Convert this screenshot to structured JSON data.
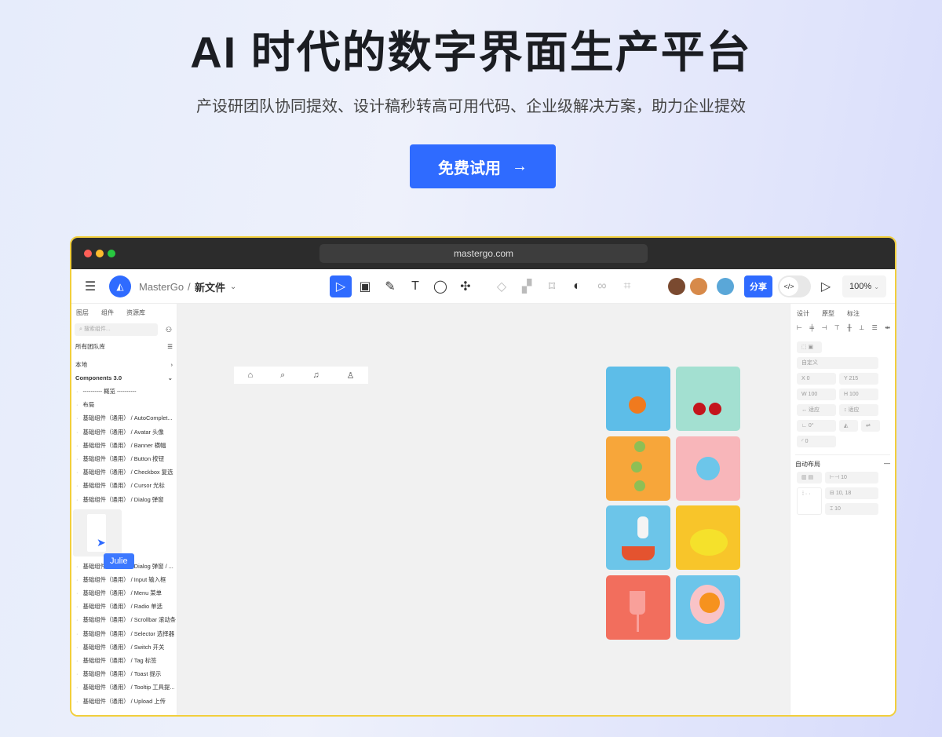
{
  "hero": {
    "title": "AI 时代的数字界面生产平台",
    "subtitle": "产设研团队协同提效、设计稿秒转高可用代码、企业级解决方案，助力企业提效",
    "cta": "免费试用",
    "cta_icon": "arrow-right-icon"
  },
  "browser": {
    "url": "mastergo.com"
  },
  "toolbar": {
    "brand": "MasterGo",
    "separator": "/",
    "file_name": "新文件",
    "share": "分享",
    "zoom": "100%",
    "accent": "#2f6bff"
  },
  "left_panel": {
    "tabs": [
      "图层",
      "组件",
      "资源库"
    ],
    "search_placeholder": "搜索组件...",
    "library": "所有团队库",
    "local": "本地",
    "group": "Components 3.0",
    "items": [
      "---------- 概览 ----------",
      "布局",
      "基础组件（通用） / AutoComplet...",
      "基础组件（通用） / Avatar 头像",
      "基础组件（通用） / Banner 横幅",
      "基础组件（通用） / Button 按钮",
      "基础组件（通用） / Checkbox 复选",
      "基础组件（通用） / Cursor 光标",
      "基础组件（通用） / Dialog 弹窗"
    ],
    "items2": [
      "基础组件（通用） / Dialog 弹窗 / ...",
      "基础组件（通用） / Input 输入框",
      "基础组件（通用） / Menu 菜单",
      "基础组件（通用） / Radio 单选",
      "基础组件（通用） / Scrollbar 滚动条",
      "基础组件（通用） / Selector 选择器",
      "基础组件（通用） / Switch 开关",
      "基础组件（通用） / Tag 标签",
      "基础组件（通用） / Toast 提示",
      "基础组件（通用） / Tooltip 工具提...",
      "基础组件（通用） / Upload 上传"
    ],
    "cursor_user": "Julie"
  },
  "right_panel": {
    "tabs": [
      "设计",
      "原型",
      "标注"
    ],
    "preset": "自定义",
    "x": "X  0",
    "y": "Y  215",
    "w": "W  100",
    "h": "H  100",
    "fit_w": "适应",
    "fit_h": "适应",
    "rotation": "0°",
    "radius": "0",
    "auto_layout": "自动布局",
    "gap": "10",
    "padding": "10, 18",
    "spacing": "10"
  }
}
